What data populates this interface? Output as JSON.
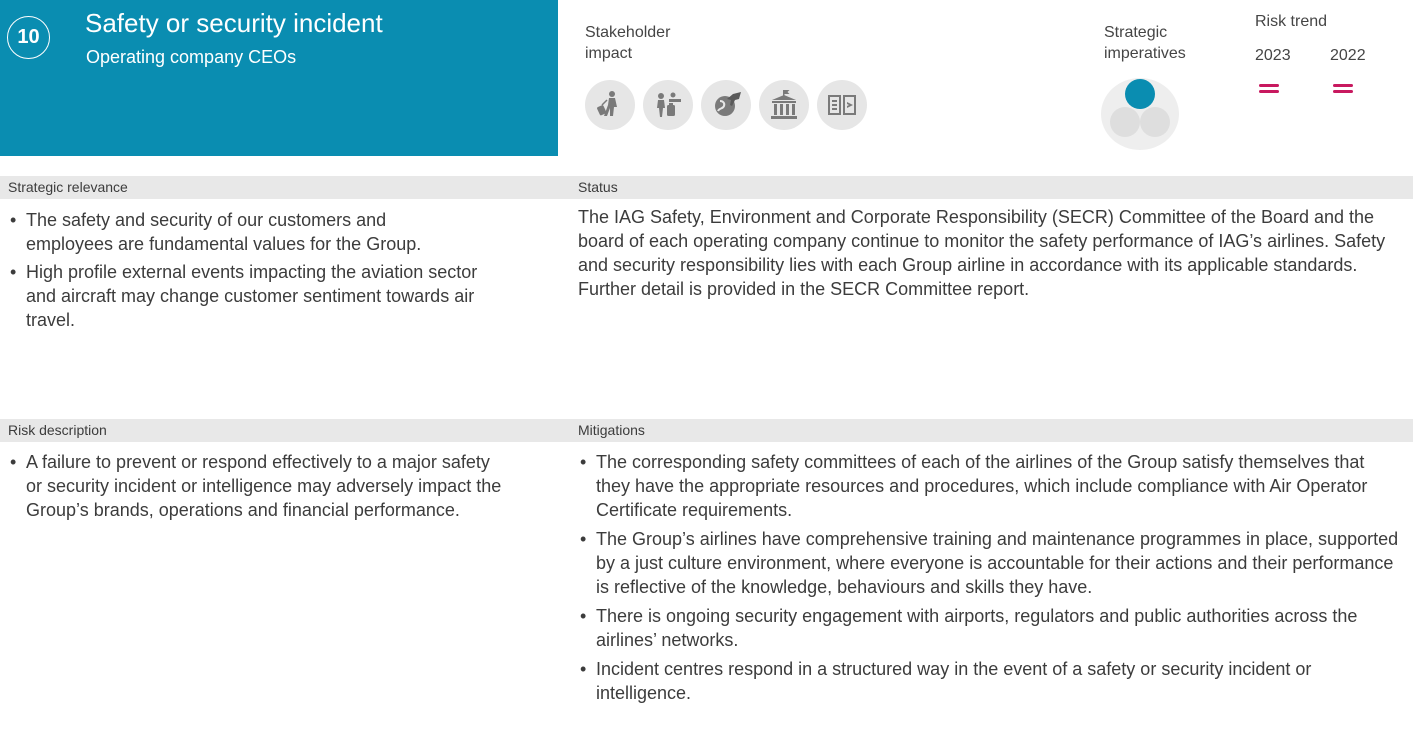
{
  "header": {
    "number": "10",
    "title": "Safety or security incident",
    "owner": "Operating company CEOs",
    "background_color": "#0a8db1"
  },
  "stakeholder_impact": {
    "label": "Stakeholder impact",
    "icons": [
      "traveller-with-luggage-icon",
      "customer-service-icon",
      "globe-aircraft-icon",
      "government-building-icon",
      "open-book-icon"
    ]
  },
  "strategic_imperatives": {
    "label": "Strategic imperatives",
    "active_segment": "top",
    "active_color": "#0a8db1"
  },
  "risk_trend": {
    "label": "Risk trend",
    "years": [
      "2023",
      "2022"
    ],
    "trend": [
      "unchanged",
      "unchanged"
    ],
    "trend_color": "#c8195f"
  },
  "strategic_relevance": {
    "label": "Strategic relevance",
    "items": [
      "The safety and security of our customers and employees are fundamental values for the Group.",
      "High profile external events impacting the aviation sector and aircraft may change customer sentiment towards air travel."
    ]
  },
  "status": {
    "label": "Status",
    "text": "The IAG Safety, Environment and Corporate Responsibility (SECR) Committee of the Board and the board of each operating company continue to monitor the safety performance of IAG’s airlines. Safety and security responsibility lies with each Group airline in accordance with its applicable standards. Further detail is provided in the SECR Committee report."
  },
  "risk_description": {
    "label": "Risk description",
    "items": [
      "A failure to prevent or respond effectively to a major safety or security incident or intelligence may adversely impact the Group’s brands, operations and financial performance."
    ]
  },
  "mitigations": {
    "label": "Mitigations",
    "items": [
      "The corresponding safety committees of each of the airlines of the Group satisfy themselves that they have the appropriate resources and procedures, which include compliance with Air Operator Certificate requirements.",
      "The Group’s airlines have comprehensive training and maintenance programmes in place, supported by a just culture environment, where everyone is accountable for their actions and their performance is reflective of the knowledge, behaviours and skills they have.",
      "There is ongoing security engagement with airports, regulators and public authorities across the airlines’ networks.",
      "Incident centres respond in a structured way in the event of a safety or security incident or intelligence."
    ]
  }
}
